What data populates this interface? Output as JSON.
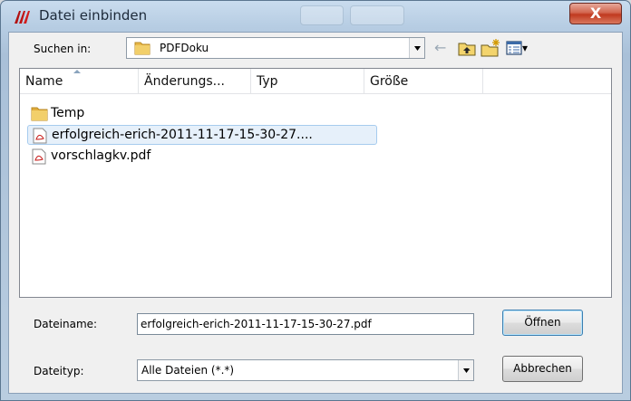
{
  "window": {
    "title": "Datei einbinden",
    "close_glyph": "X"
  },
  "lookin": {
    "label": "Suchen in:",
    "value": "PDFDoku"
  },
  "columns": [
    "Name",
    "Änderungs...",
    "Typ",
    "Größe"
  ],
  "files": [
    {
      "name": "Temp",
      "icon": "folder-icon"
    },
    {
      "name": "erfolgreich-erich-2011-11-17-15-30-27....",
      "icon": "pdf-file-icon",
      "selected": true
    },
    {
      "name": "vorschlagkv.pdf",
      "icon": "pdf-file-icon"
    }
  ],
  "filename": {
    "label": "Dateiname:",
    "value": "erfolgreich-erich-2011-11-17-15-30-27.pdf"
  },
  "filetype": {
    "label": "Dateityp:",
    "value": "Alle Dateien (*.*)"
  },
  "buttons": {
    "open": "Öffnen",
    "cancel": "Abbrechen"
  },
  "icons": {
    "back": "←",
    "view_menu": "▾"
  }
}
